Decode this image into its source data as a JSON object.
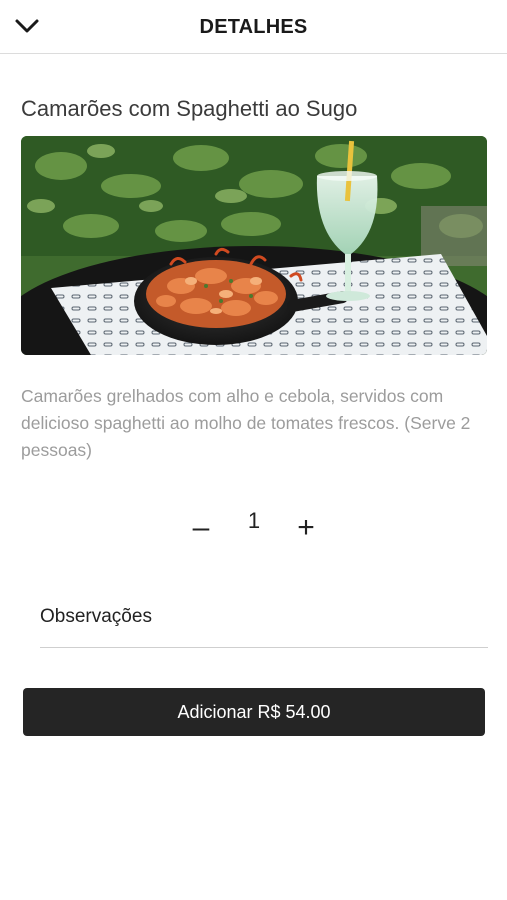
{
  "header": {
    "title": "DETALHES",
    "back_icon": "chevron-down-icon"
  },
  "product": {
    "name": "Camarões com Spaghetti ao Sugo",
    "description": "Camarões grelhados com alho e cebola, servidos com delicioso spaghetti ao molho de tomates frescos. (Serve 2 pessoas)"
  },
  "quantity": {
    "minus_label": "–",
    "value": "1",
    "plus_label": "+"
  },
  "observations": {
    "placeholder": "Observações",
    "value": ""
  },
  "add_button": {
    "label": "Adicionar R$ 54.00"
  },
  "colors": {
    "button_bg": "#252525",
    "description_text": "#9c9c9c"
  }
}
